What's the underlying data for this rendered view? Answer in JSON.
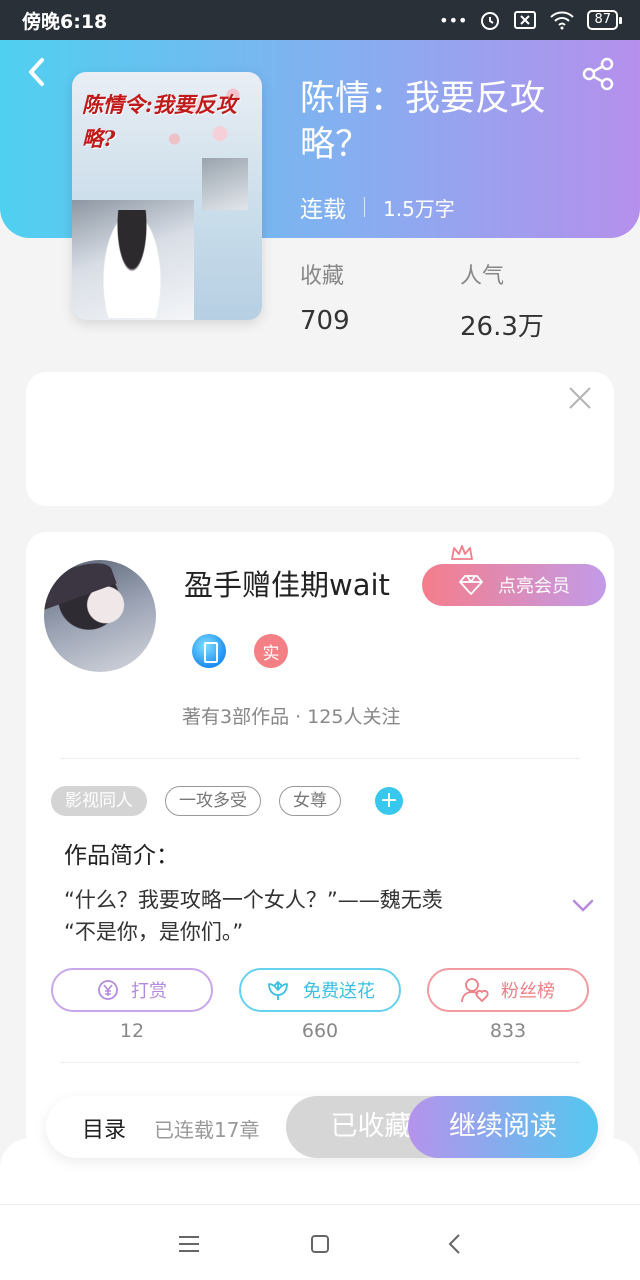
{
  "status_bar": {
    "time": "傍晚6:18",
    "dots": "•••",
    "battery": "87"
  },
  "book": {
    "title": "陈情：我要反攻略？",
    "status": "连载",
    "word_count": "1.5万字",
    "cover_text": "陈情令:我要反攻略?",
    "stats": {
      "collect_label": "收藏",
      "collect_value": "709",
      "popularity_label": "人气",
      "popularity_value": "26.3万"
    }
  },
  "author": {
    "name": "盈手赠佳期wait",
    "vip_button": "点亮会员",
    "real_badge": "实",
    "info": "著有3部作品 · 125人关注"
  },
  "tags": [
    "影视同人",
    "一攻多受",
    "女尊"
  ],
  "tag_add": "+",
  "intro": {
    "title": "作品简介：",
    "line1": "“什么？我要攻略一个女人？”——魏无羡",
    "line2": "“不是你，是你们。”"
  },
  "actions": [
    {
      "label": "打赏",
      "count": "12",
      "icon": "yen-icon"
    },
    {
      "label": "免费送花",
      "count": "660",
      "icon": "flower-icon"
    },
    {
      "label": "粉丝榜",
      "count": "833",
      "icon": "fans-icon"
    }
  ],
  "bottom_bar": {
    "catalog": "目录",
    "chapters": "已连载17章",
    "collected": "已收藏",
    "read": "继续阅读"
  },
  "colors": {
    "header_start": "#4fd0f0",
    "header_end": "#b590ec",
    "vip_start": "#f57d8b",
    "vip_end": "#c29be9",
    "accent_cyan": "#38c8ee"
  }
}
